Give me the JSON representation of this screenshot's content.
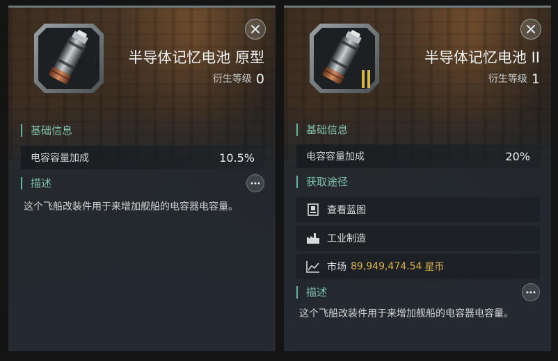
{
  "left_panel": {
    "title": "半导体记忆电池 原型",
    "rank_label": "衍生等级",
    "rank_value": "0",
    "basic_info_header": "基础信息",
    "stat_label": "电容容量加成",
    "stat_value": "10.5%",
    "desc_header": "描述",
    "description": "这个飞船改装件用于来增加舰船的电容器电容量。"
  },
  "right_panel": {
    "title": "半导体记忆电池 II",
    "rank_label": "衍生等级",
    "rank_value": "1",
    "basic_info_header": "基础信息",
    "stat_label": "电容容量加成",
    "stat_value": "20%",
    "acquire_header": "获取途径",
    "sources": [
      {
        "label": "查看蓝图",
        "icon": "blueprint-icon"
      },
      {
        "label": "工业制造",
        "icon": "factory-icon"
      },
      {
        "label": "市场",
        "icon": "market-chart-icon",
        "price": "89,949,474.54",
        "currency": "星币"
      }
    ],
    "desc_header": "描述",
    "description": "这个飞船改装件用于来增加舰船的电容器电容量。",
    "tech_badge": "II"
  },
  "colors": {
    "accent": "#63b79e",
    "price": "#d8b44a",
    "title": "#f2f4f4"
  }
}
